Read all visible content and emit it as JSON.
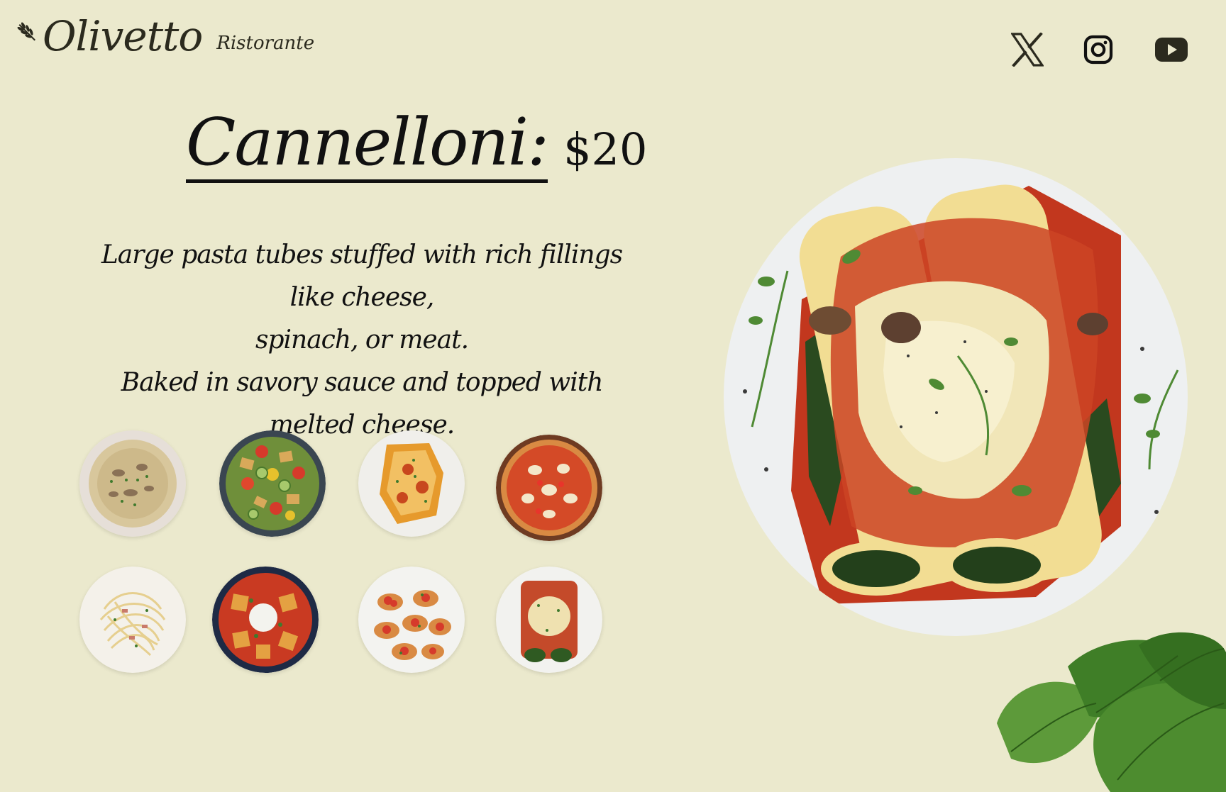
{
  "brand": {
    "name": "Olivetto",
    "subtitle": "Ristorante",
    "logo_icon": "olive-branch-icon"
  },
  "social": [
    {
      "icon": "x-icon",
      "label": "X"
    },
    {
      "icon": "instagram-icon",
      "label": "Instagram"
    },
    {
      "icon": "youtube-icon",
      "label": "YouTube"
    }
  ],
  "dish": {
    "name": "Cannelloni:",
    "price": "$20",
    "description_lines": [
      "Large pasta tubes stuffed with rich fillings like cheese,",
      "spinach, or meat.",
      "Baked in savory sauce and topped with melted cheese."
    ]
  },
  "gallery": [
    {
      "dish": "mushroom-risotto"
    },
    {
      "dish": "panzanella-salad"
    },
    {
      "dish": "baked-pasta"
    },
    {
      "dish": "margherita-pizza"
    },
    {
      "dish": "carbonara"
    },
    {
      "dish": "ravioli-burrata"
    },
    {
      "dish": "bruschetta"
    },
    {
      "dish": "cannelloni"
    }
  ],
  "colors": {
    "background": "#ebe9cd",
    "text": "#111111",
    "icon": "#2b2a1e"
  }
}
